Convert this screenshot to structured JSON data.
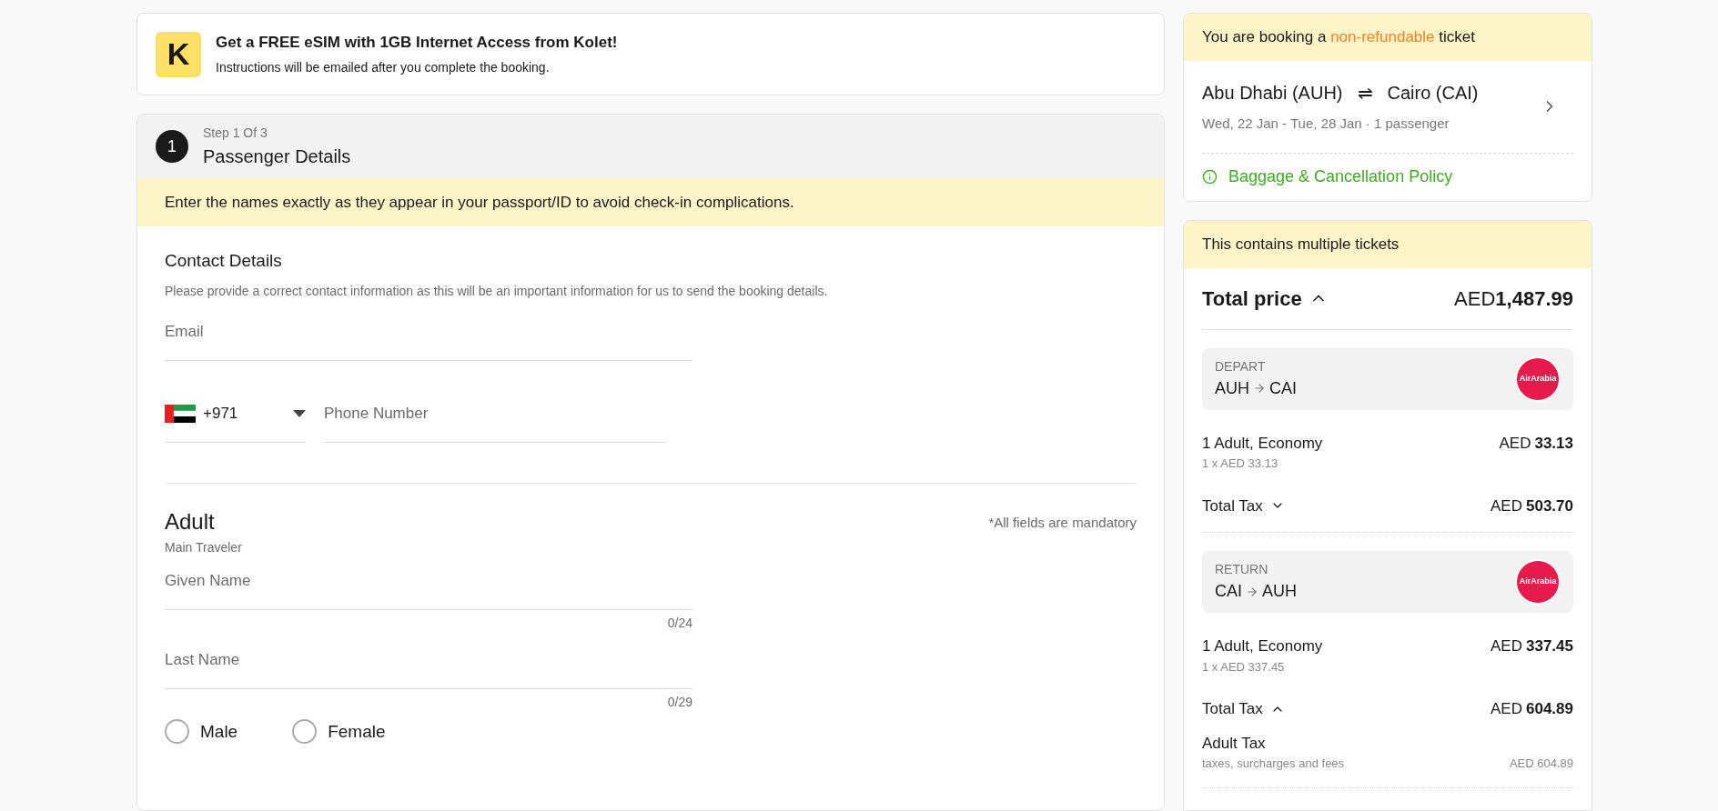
{
  "promo": {
    "title": "Get a FREE eSIM with 1GB Internet Access from Kolet!",
    "subtitle": "Instructions will be emailed after you complete the booking.",
    "logo_letter": "K"
  },
  "step": {
    "number": "1",
    "caption": "Step 1 Of 3",
    "title": "Passenger Details",
    "notice": "Enter the names exactly as they appear in your passport/ID to avoid check-in complications."
  },
  "contact": {
    "title": "Contact Details",
    "subtitle": "Please provide a correct contact information as this will be an important information for us to send the booking details.",
    "email": {
      "placeholder": "Email"
    },
    "country_code": "+971",
    "phone": {
      "placeholder": "Phone Number"
    }
  },
  "traveler": {
    "title": "Adult",
    "subtitle": "Main Traveler",
    "mandatory_note": "*All fields are mandatory",
    "fields": [
      {
        "placeholder": "Given Name",
        "counter": "0/24"
      },
      {
        "placeholder": "Last Name",
        "counter": "0/29"
      }
    ],
    "genders": [
      {
        "label": "Male",
        "selected": false
      },
      {
        "label": "Female",
        "selected": false
      }
    ]
  },
  "trip": {
    "notice": "You are booking a **non-refundable** ticket",
    "origin": "Abu Dhabi (AUH)",
    "destination": "Cairo (CAI)",
    "route_symbol": "⇌",
    "details": "Wed, 22 Jan - Tue, 28 Jan · 1 passenger",
    "policy_link": "Baggage & Cancellation Policy"
  },
  "price": {
    "notice": "This contains multiple tickets",
    "title": "Total price",
    "expanded": true,
    "currency": "AED",
    "total": "1,487.99",
    "legs": [
      {
        "label": "DEPART",
        "from": "AUH",
        "to": "CAI",
        "airline_logo": "AirArabia",
        "fare": "1 Adult, Economy",
        "fare_detail": "1 x AED 33.13",
        "fare_currency": "AED",
        "fare_amount": "33.13",
        "tax_label": "Total Tax",
        "tax_expanded": false,
        "tax_currency": "AED",
        "tax_amount": "503.70"
      },
      {
        "label": "RETURN",
        "from": "CAI",
        "to": "AUH",
        "airline_logo": "AirArabia",
        "fare": "1 Adult, Economy",
        "fare_detail": "1 x AED 337.45",
        "fare_currency": "AED",
        "fare_amount": "337.45",
        "tax_label": "Total Tax",
        "tax_expanded": true,
        "tax_currency": "AED",
        "tax_amount": "604.89",
        "tax_items": [
          {
            "name": "Adult Tax",
            "detail": "taxes, surcharges and fees",
            "amount": "AED 604.89"
          }
        ]
      }
    ]
  }
}
